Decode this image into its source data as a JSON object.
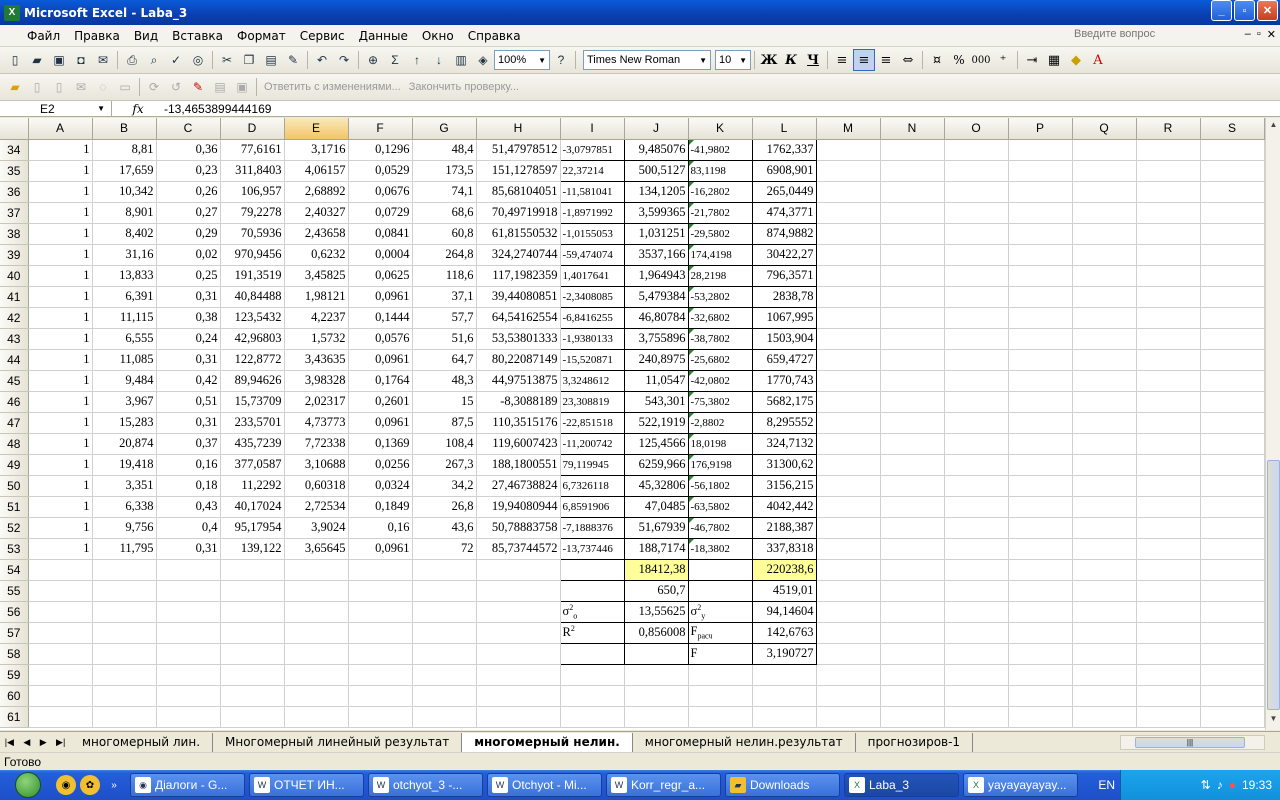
{
  "window": {
    "title": "Microsoft Excel - Laba_3"
  },
  "menu": [
    "Файл",
    "Правка",
    "Вид",
    "Вставка",
    "Формат",
    "Сервис",
    "Данные",
    "Окно",
    "Справка"
  ],
  "ask_placeholder": "Введите вопрос",
  "toolbar": {
    "zoom": "100%",
    "font": "Times New Roman",
    "size": "10",
    "bold": "Ж",
    "italic": "К",
    "underline": "Ч",
    "percent": "%",
    "thousands": "000"
  },
  "review": {
    "reply": "Ответить с изменениями...",
    "end": "Закончить проверку..."
  },
  "formula": {
    "cell": "E2",
    "fx": "fx",
    "value": "-13,4653899444169"
  },
  "columns": [
    "A",
    "B",
    "C",
    "D",
    "E",
    "F",
    "G",
    "H",
    "I",
    "J",
    "K",
    "L",
    "M",
    "N",
    "O",
    "P",
    "Q",
    "R",
    "S"
  ],
  "rows": [
    {
      "n": "34",
      "c": [
        "1",
        "8,81",
        "0,36",
        "77,6161",
        "3,1716",
        "0,1296",
        "48,4",
        "51,47978512",
        "-3,0797851",
        "9,485076",
        "-41,9802",
        "1762,337"
      ]
    },
    {
      "n": "35",
      "c": [
        "1",
        "17,659",
        "0,23",
        "311,8403",
        "4,06157",
        "0,0529",
        "173,5",
        "151,1278597",
        "22,37214",
        "500,5127",
        "83,1198",
        "6908,901"
      ]
    },
    {
      "n": "36",
      "c": [
        "1",
        "10,342",
        "0,26",
        "106,957",
        "2,68892",
        "0,0676",
        "74,1",
        "85,68104051",
        "-11,581041",
        "134,1205",
        "-16,2802",
        "265,0449"
      ]
    },
    {
      "n": "37",
      "c": [
        "1",
        "8,901",
        "0,27",
        "79,2278",
        "2,40327",
        "0,0729",
        "68,6",
        "70,49719918",
        "-1,8971992",
        "3,599365",
        "-21,7802",
        "474,3771"
      ]
    },
    {
      "n": "38",
      "c": [
        "1",
        "8,402",
        "0,29",
        "70,5936",
        "2,43658",
        "0,0841",
        "60,8",
        "61,81550532",
        "-1,0155053",
        "1,031251",
        "-29,5802",
        "874,9882"
      ]
    },
    {
      "n": "39",
      "c": [
        "1",
        "31,16",
        "0,02",
        "970,9456",
        "0,6232",
        "0,0004",
        "264,8",
        "324,2740744",
        "-59,474074",
        "3537,166",
        "174,4198",
        "30422,27"
      ]
    },
    {
      "n": "40",
      "c": [
        "1",
        "13,833",
        "0,25",
        "191,3519",
        "3,45825",
        "0,0625",
        "118,6",
        "117,1982359",
        "1,4017641",
        "1,964943",
        "28,2198",
        "796,3571"
      ]
    },
    {
      "n": "41",
      "c": [
        "1",
        "6,391",
        "0,31",
        "40,84488",
        "1,98121",
        "0,0961",
        "37,1",
        "39,44080851",
        "-2,3408085",
        "5,479384",
        "-53,2802",
        "2838,78"
      ]
    },
    {
      "n": "42",
      "c": [
        "1",
        "11,115",
        "0,38",
        "123,5432",
        "4,2237",
        "0,1444",
        "57,7",
        "64,54162554",
        "-6,8416255",
        "46,80784",
        "-32,6802",
        "1067,995"
      ]
    },
    {
      "n": "43",
      "c": [
        "1",
        "6,555",
        "0,24",
        "42,96803",
        "1,5732",
        "0,0576",
        "51,6",
        "53,53801333",
        "-1,9380133",
        "3,755896",
        "-38,7802",
        "1503,904"
      ]
    },
    {
      "n": "44",
      "c": [
        "1",
        "11,085",
        "0,31",
        "122,8772",
        "3,43635",
        "0,0961",
        "64,7",
        "80,22087149",
        "-15,520871",
        "240,8975",
        "-25,6802",
        "659,4727"
      ]
    },
    {
      "n": "45",
      "c": [
        "1",
        "9,484",
        "0,42",
        "89,94626",
        "3,98328",
        "0,1764",
        "48,3",
        "44,97513875",
        "3,3248612",
        "11,0547",
        "-42,0802",
        "1770,743"
      ]
    },
    {
      "n": "46",
      "c": [
        "1",
        "3,967",
        "0,51",
        "15,73709",
        "2,02317",
        "0,2601",
        "15",
        "-8,3088189",
        "23,308819",
        "543,301",
        "-75,3802",
        "5682,175"
      ]
    },
    {
      "n": "47",
      "c": [
        "1",
        "15,283",
        "0,31",
        "233,5701",
        "4,73773",
        "0,0961",
        "87,5",
        "110,3515176",
        "-22,851518",
        "522,1919",
        "-2,8802",
        "8,295552"
      ]
    },
    {
      "n": "48",
      "c": [
        "1",
        "20,874",
        "0,37",
        "435,7239",
        "7,72338",
        "0,1369",
        "108,4",
        "119,6007423",
        "-11,200742",
        "125,4566",
        "18,0198",
        "324,7132"
      ]
    },
    {
      "n": "49",
      "c": [
        "1",
        "19,418",
        "0,16",
        "377,0587",
        "3,10688",
        "0,0256",
        "267,3",
        "188,1800551",
        "79,119945",
        "6259,966",
        "176,9198",
        "31300,62"
      ]
    },
    {
      "n": "50",
      "c": [
        "1",
        "3,351",
        "0,18",
        "11,2292",
        "0,60318",
        "0,0324",
        "34,2",
        "27,46738824",
        "6,7326118",
        "45,32806",
        "-56,1802",
        "3156,215"
      ]
    },
    {
      "n": "51",
      "c": [
        "1",
        "6,338",
        "0,43",
        "40,17024",
        "2,72534",
        "0,1849",
        "26,8",
        "19,94080944",
        "6,8591906",
        "47,0485",
        "-63,5802",
        "4042,442"
      ]
    },
    {
      "n": "52",
      "c": [
        "1",
        "9,756",
        "0,4",
        "95,17954",
        "3,9024",
        "0,16",
        "43,6",
        "50,78883758",
        "-7,1888376",
        "51,67939",
        "-46,7802",
        "2188,387"
      ]
    },
    {
      "n": "53",
      "c": [
        "1",
        "11,795",
        "0,31",
        "139,122",
        "3,65645",
        "0,0961",
        "72",
        "85,73744572",
        "-13,737446",
        "188,7174",
        "-18,3802",
        "337,8318"
      ]
    }
  ],
  "summary": {
    "r54": {
      "n": "54",
      "J": "18412,38",
      "L": "220238,6"
    },
    "r55": {
      "n": "55",
      "J": "650,7",
      "L": "4519,01"
    },
    "r56": {
      "n": "56",
      "I_base": "σ",
      "I_sup": "2",
      "I_sub": "o",
      "J": "13,55625",
      "K_base": "σ",
      "K_sup": "2",
      "K_sub": "y",
      "L": "94,14604"
    },
    "r57": {
      "n": "57",
      "I_base": "R",
      "I_sup": "2",
      "J": "0,856008",
      "K_base": "F",
      "K_sub": "расч",
      "L": "142,6763"
    },
    "r58": {
      "n": "58",
      "K": "F",
      "L": "3,190727"
    },
    "r59": {
      "n": "59"
    },
    "r60": {
      "n": "60"
    },
    "r61": {
      "n": "61"
    }
  },
  "tabs": [
    "многомерный лин.",
    "Многомерный линейный результат",
    "многомерный нелин.",
    "многомерный нелин.результат",
    "прогнозиров-1"
  ],
  "status": "Готово",
  "taskbar": {
    "tasks": [
      "Діалоги - G...",
      "ОТЧЕТ ИН...",
      "otchyot_3 -...",
      "Otchyot - Mi...",
      "Korr_regr_a...",
      "Downloads",
      "Laba_3",
      "yayayayayay..."
    ],
    "lang": "EN",
    "clock": "19:33"
  }
}
